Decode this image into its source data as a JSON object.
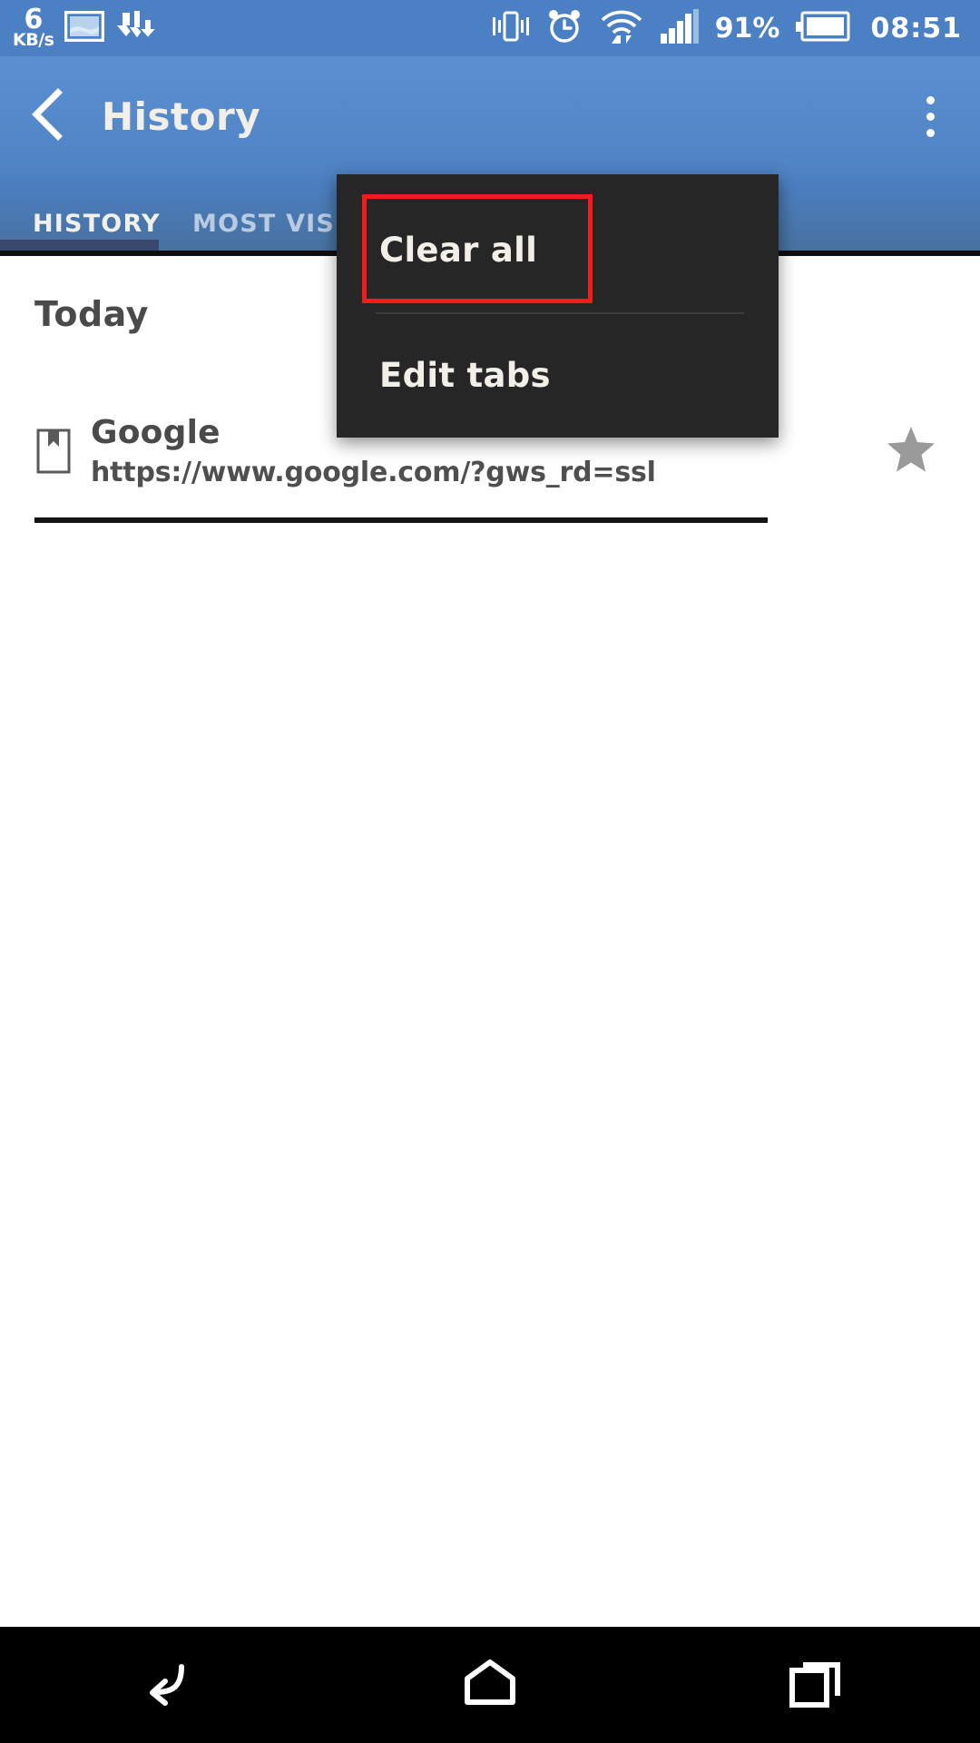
{
  "status_bar": {
    "net_speed_value": "6",
    "net_speed_unit": "KB/s",
    "icons": [
      "image-icon",
      "downloads-icon",
      "vibrate-icon",
      "alarm-icon",
      "wifi-icon",
      "signal-icon"
    ],
    "battery_percent": "91%",
    "battery_icon": "battery-icon",
    "clock": "08:51",
    "background_color": "#4c80c4"
  },
  "app_bar": {
    "back_icon": "back-chevron-icon",
    "title": "History",
    "overflow_icon": "overflow-menu-icon",
    "background_color": "#4f82c3"
  },
  "tabs": {
    "items": [
      {
        "label": "HISTORY",
        "active": true
      },
      {
        "label": "MOST VISITED",
        "active": false
      }
    ],
    "indicator_color": "#39496d",
    "active_color": "#f3f0ea",
    "inactive_color": "#b8cbe2"
  },
  "content": {
    "section_header": "Today",
    "rows": [
      {
        "icon": "page-bookmark-icon",
        "title": "Google",
        "url": "https://www.google.com/?gws_rd=ssl",
        "star_icon": "star-icon"
      }
    ]
  },
  "overflow_menu": {
    "background_color": "#262626",
    "items": [
      {
        "label": "Clear all",
        "highlighted": true
      },
      {
        "label": "Edit tabs",
        "highlighted": false
      }
    ],
    "highlight_color": "#f41b1b"
  },
  "nav_bar": {
    "background_color": "#000000",
    "buttons": [
      {
        "icon": "back-nav-icon"
      },
      {
        "icon": "home-nav-icon"
      },
      {
        "icon": "recents-nav-icon"
      }
    ]
  }
}
